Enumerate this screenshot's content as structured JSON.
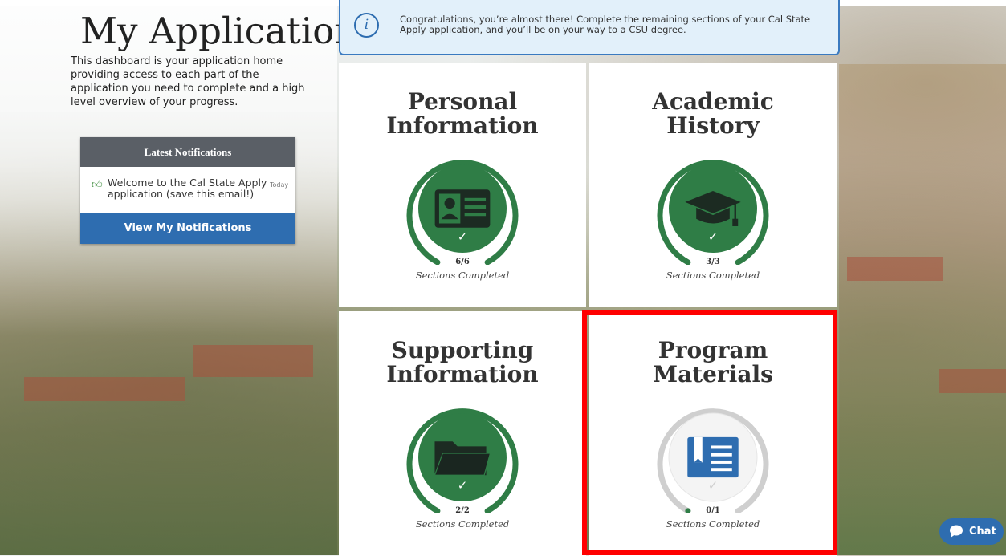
{
  "header": {
    "title": "My Application"
  },
  "intro": {
    "text": "This dashboard is your application home providing access to each part of the application you need to complete and a high level overview of your progress."
  },
  "notifications": {
    "header": "Latest Notifications",
    "items": [
      {
        "text": "Welcome to the Cal State Apply application (save this email!)",
        "time": "Today"
      }
    ],
    "button_label": "View My Notifications"
  },
  "banner": {
    "text": "Congratulations, you’re almost there! Complete the remaining sections of your Cal State Apply application, and you’ll be on your way to a CSU degree."
  },
  "tiles": [
    {
      "title_line1": "Personal",
      "title_line2": "Information",
      "count": "6/6",
      "label": "Sections Completed",
      "icon": "id-card-icon",
      "completed": true,
      "progress": 1.0
    },
    {
      "title_line1": "Academic",
      "title_line2": "History",
      "count": "3/3",
      "label": "Sections Completed",
      "icon": "graduation-cap-icon",
      "completed": true,
      "progress": 1.0
    },
    {
      "title_line1": "Supporting",
      "title_line2": "Information",
      "count": "2/2",
      "label": "Sections Completed",
      "icon": "folder-icon",
      "completed": true,
      "progress": 1.0
    },
    {
      "title_line1": "Program",
      "title_line2": "Materials",
      "count": "0/1",
      "label": "Sections Completed",
      "icon": "book-icon",
      "completed": false,
      "progress": 0.0
    }
  ],
  "colors": {
    "complete_green": "#2f7d46",
    "incomplete_gray": "#c8c8c8",
    "primary_blue": "#2e6db0",
    "highlight_red": "#ff0000"
  },
  "chat": {
    "label": "Chat"
  }
}
